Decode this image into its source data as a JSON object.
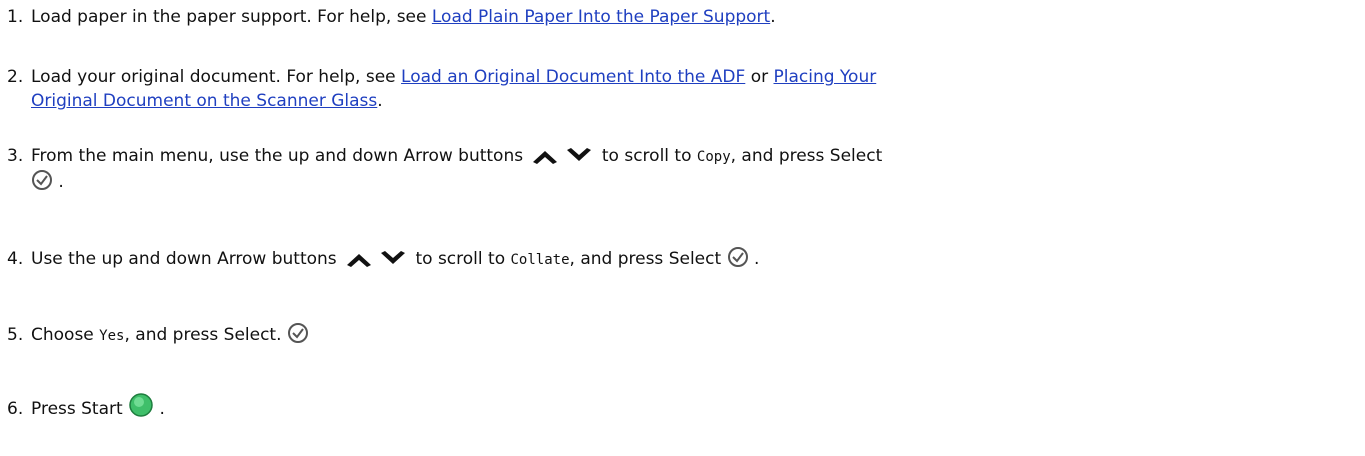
{
  "steps": [
    {
      "num": "1.",
      "text_a": "Load paper in the paper support. For help, see ",
      "link_a": "Load Plain Paper Into the Paper Support",
      "text_b": "."
    },
    {
      "num": "2.",
      "text_a": "Load your original document. For help, see ",
      "link_a": "Load an Original Document Into the ADF",
      "text_mid": " or ",
      "link_b_line1": "Placing Your",
      "link_b_line2": "Original Document on the Scanner Glass",
      "text_b": "."
    },
    {
      "num": "3.",
      "text_a": "From the main menu, use the up and down Arrow buttons ",
      "text_b": " to scroll to ",
      "code": "Copy",
      "text_c": ", and press Select",
      "text_d": " ."
    },
    {
      "num": "4.",
      "text_a": "Use the up and down Arrow buttons ",
      "text_b": " to scroll to ",
      "code": "Collate",
      "text_c": ", and press Select ",
      "text_d": " ."
    },
    {
      "num": "5.",
      "text_a": "Choose ",
      "code": "Yes",
      "text_b": ", and press Select. "
    },
    {
      "num": "6.",
      "text_a": "Press Start ",
      "text_b": " ."
    }
  ],
  "icons": {
    "up": "up-arrow-icon",
    "down": "down-arrow-icon",
    "select": "select-check-icon",
    "start": "start-button-icon"
  },
  "colors": {
    "link": "#1f3fc0",
    "text": "#111111",
    "start_green": "#3fbf6a"
  }
}
